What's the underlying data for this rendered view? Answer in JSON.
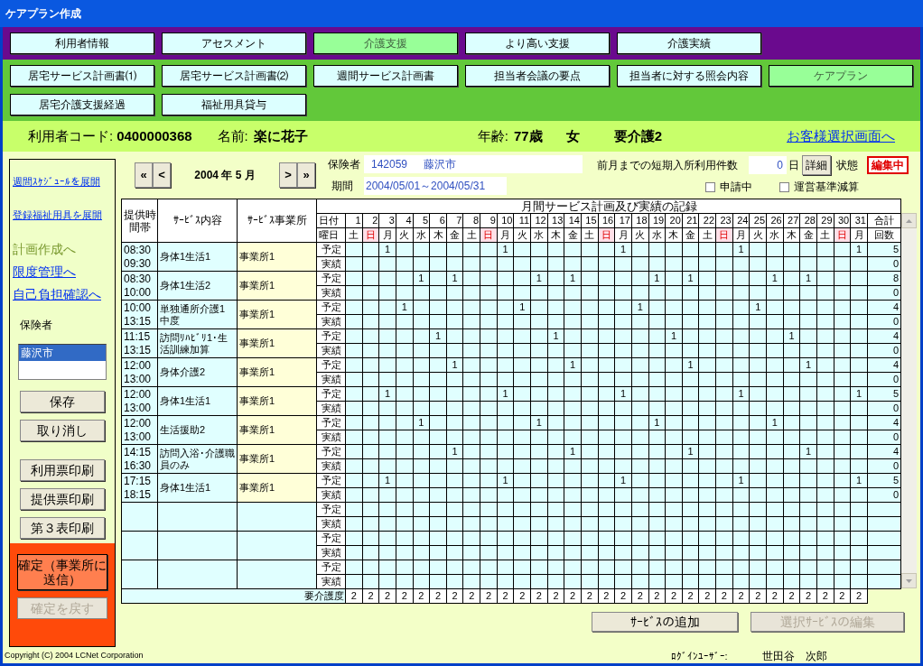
{
  "window": {
    "title": "ケアプラン作成"
  },
  "nav_primary": [
    {
      "label": "利用者情報",
      "selected": false
    },
    {
      "label": "アセスメント",
      "selected": false
    },
    {
      "label": "介護支援",
      "selected": true
    },
    {
      "label": "より高い支援",
      "selected": false
    },
    {
      "label": "介護実績",
      "selected": false
    }
  ],
  "nav_secondary": [
    {
      "label": "居宅サービス計画書⑴",
      "selected": false
    },
    {
      "label": "居宅サービス計画書⑵",
      "selected": false
    },
    {
      "label": "週間サービス計画書",
      "selected": false
    },
    {
      "label": "担当者会議の要点",
      "selected": false
    },
    {
      "label": "担当者に対する照会内容",
      "selected": false
    },
    {
      "label": "ケアプラン",
      "selected": true
    },
    {
      "label": "居宅介護支援経過",
      "selected": false
    },
    {
      "label": "福祉用具貸与",
      "selected": false
    }
  ],
  "user_bar": {
    "code_label": "利用者コード:",
    "code": "0400000368",
    "name_label": "名前:",
    "name": "楽に花子",
    "age_label": "年齢:",
    "age": "77歳",
    "sex": "女",
    "care_level": "要介護2",
    "back_link": "お客様選択画面へ"
  },
  "left_panel": {
    "expand_links": [
      "週間ｽｹｼﾞｭｰﾙを展開",
      "登録福祉用具を展開"
    ],
    "nav_links": [
      {
        "label": "計画作成へ",
        "disabled": true
      },
      {
        "label": "限度管理へ",
        "disabled": false
      },
      {
        "label": "自己負担確認へ",
        "disabled": false
      }
    ],
    "insurer_label": "保険者",
    "insurer_list": [
      {
        "label": "藤沢市",
        "selected": true
      }
    ],
    "edit_buttons": [
      "保存",
      "取り消し"
    ],
    "print_buttons": [
      "利用票印刷",
      "提供票印刷",
      "第３表印刷"
    ],
    "confirm_button": "確定（事業所に送信）",
    "undo_button": {
      "label": "確定を戻す",
      "disabled": true
    }
  },
  "month_nav": {
    "first": "«",
    "prev": "<",
    "month": "2004 年 5 月",
    "next": ">",
    "last": "»"
  },
  "insurer": {
    "label": "保険者",
    "code": "142059",
    "name": "藤沢市"
  },
  "period": {
    "label": "期間",
    "value": "2004/05/01～2004/05/31"
  },
  "short_stay": {
    "label": "前月までの短期入所利用件数",
    "value": "0",
    "unit": "日",
    "detail_button": "詳細"
  },
  "status": {
    "label": "状態",
    "value": "編集中"
  },
  "checkboxes": [
    {
      "label": "申請中",
      "checked": false
    },
    {
      "label": "運営基準減算",
      "checked": false
    }
  ],
  "schedule": {
    "headers": {
      "time": "提供時間帯",
      "service": "ｻｰﾋﾞｽ内容",
      "provider": "ｻｰﾋﾞｽ事業所",
      "title": "月間サービス計画及び実績の記録",
      "date_label": "日付",
      "weekday_label": "曜日",
      "total_label": "合計",
      "count_label": "回数"
    },
    "days": [
      {
        "day": "1",
        "weekday": "土",
        "sunday": false
      },
      {
        "day": "2",
        "weekday": "日",
        "sunday": true
      },
      {
        "day": "3",
        "weekday": "月",
        "sunday": false
      },
      {
        "day": "4",
        "weekday": "火",
        "sunday": false
      },
      {
        "day": "5",
        "weekday": "水",
        "sunday": false
      },
      {
        "day": "6",
        "weekday": "木",
        "sunday": false
      },
      {
        "day": "7",
        "weekday": "金",
        "sunday": false
      },
      {
        "day": "8",
        "weekday": "土",
        "sunday": false
      },
      {
        "day": "9",
        "weekday": "日",
        "sunday": true
      },
      {
        "day": "10",
        "weekday": "月",
        "sunday": false
      },
      {
        "day": "11",
        "weekday": "火",
        "sunday": false
      },
      {
        "day": "12",
        "weekday": "水",
        "sunday": false
      },
      {
        "day": "13",
        "weekday": "木",
        "sunday": false
      },
      {
        "day": "14",
        "weekday": "金",
        "sunday": false
      },
      {
        "day": "15",
        "weekday": "土",
        "sunday": false
      },
      {
        "day": "16",
        "weekday": "日",
        "sunday": true
      },
      {
        "day": "17",
        "weekday": "月",
        "sunday": false
      },
      {
        "day": "18",
        "weekday": "火",
        "sunday": false
      },
      {
        "day": "19",
        "weekday": "水",
        "sunday": false
      },
      {
        "day": "20",
        "weekday": "木",
        "sunday": false
      },
      {
        "day": "21",
        "weekday": "金",
        "sunday": false
      },
      {
        "day": "22",
        "weekday": "土",
        "sunday": false
      },
      {
        "day": "23",
        "weekday": "日",
        "sunday": true
      },
      {
        "day": "24",
        "weekday": "月",
        "sunday": false
      },
      {
        "day": "25",
        "weekday": "火",
        "sunday": false
      },
      {
        "day": "26",
        "weekday": "水",
        "sunday": false
      },
      {
        "day": "27",
        "weekday": "木",
        "sunday": false
      },
      {
        "day": "28",
        "weekday": "金",
        "sunday": false
      },
      {
        "day": "29",
        "weekday": "土",
        "sunday": false
      },
      {
        "day": "30",
        "weekday": "日",
        "sunday": true
      },
      {
        "day": "31",
        "weekday": "月",
        "sunday": false
      }
    ],
    "rows": [
      {
        "start": "08:30",
        "end": "09:30",
        "service": "身体1生活1",
        "provider": "事業所1",
        "plan_label": "予定",
        "actual_label": "実績",
        "planned": [
          {
            "kind": "blank"
          },
          {
            "kind": "blank"
          },
          {
            "kind": "mark",
            "text": "1"
          },
          {
            "kind": "blank"
          },
          {
            "kind": "blank"
          },
          {
            "kind": "blank"
          },
          {
            "kind": "blank"
          },
          {
            "kind": "blank"
          },
          {
            "kind": "blank"
          },
          {
            "kind": "mark",
            "text": "1"
          },
          {
            "kind": "blank"
          },
          {
            "kind": "blank"
          },
          {
            "kind": "blank"
          },
          {
            "kind": "blank"
          },
          {
            "kind": "blank"
          },
          {
            "kind": "blank"
          },
          {
            "kind": "mark",
            "text": "1"
          },
          {
            "kind": "blank"
          },
          {
            "kind": "blank"
          },
          {
            "kind": "blank"
          },
          {
            "kind": "blank"
          },
          {
            "kind": "blank"
          },
          {
            "kind": "blank"
          },
          {
            "kind": "mark",
            "text": "1"
          },
          {
            "kind": "blank"
          },
          {
            "kind": "blank"
          },
          {
            "kind": "blank"
          },
          {
            "kind": "blank"
          },
          {
            "kind": "blank"
          },
          {
            "kind": "blank"
          },
          {
            "kind": "mark",
            "text": "1"
          }
        ],
        "plan_total": "5",
        "actual_total": "0"
      },
      {
        "start": "08:30",
        "end": "10:00",
        "service": "身体1生活2",
        "provider": "事業所1",
        "plan_label": "予定",
        "actual_label": "実績",
        "planned": [
          {
            "kind": "blank"
          },
          {
            "kind": "blank"
          },
          {
            "kind": "blank"
          },
          {
            "kind": "blank"
          },
          {
            "kind": "mark",
            "text": "1"
          },
          {
            "kind": "blank"
          },
          {
            "kind": "mark",
            "text": "1"
          },
          {
            "kind": "blank"
          },
          {
            "kind": "blank"
          },
          {
            "kind": "blank"
          },
          {
            "kind": "blank"
          },
          {
            "kind": "mark",
            "text": "1"
          },
          {
            "kind": "blank"
          },
          {
            "kind": "mark",
            "text": "1"
          },
          {
            "kind": "blank"
          },
          {
            "kind": "blank"
          },
          {
            "kind": "blank"
          },
          {
            "kind": "blank"
          },
          {
            "kind": "mark",
            "text": "1"
          },
          {
            "kind": "blank"
          },
          {
            "kind": "mark",
            "text": "1"
          },
          {
            "kind": "blank"
          },
          {
            "kind": "blank"
          },
          {
            "kind": "blank"
          },
          {
            "kind": "blank"
          },
          {
            "kind": "mark",
            "text": "1"
          },
          {
            "kind": "blank"
          },
          {
            "kind": "mark",
            "text": "1"
          },
          {
            "kind": "blank"
          },
          {
            "kind": "blank"
          },
          {
            "kind": "blank"
          }
        ],
        "plan_total": "8",
        "actual_total": "0"
      },
      {
        "start": "10:00",
        "end": "13:15",
        "service": "単独通所介護1 中度",
        "provider": "事業所1",
        "plan_label": "予定",
        "actual_label": "実績",
        "planned": [
          {
            "kind": "blank"
          },
          {
            "kind": "blank"
          },
          {
            "kind": "blank"
          },
          {
            "kind": "mark",
            "text": "1"
          },
          {
            "kind": "blank"
          },
          {
            "kind": "blank"
          },
          {
            "kind": "blank"
          },
          {
            "kind": "blank"
          },
          {
            "kind": "blank"
          },
          {
            "kind": "blank"
          },
          {
            "kind": "mark",
            "text": "1"
          },
          {
            "kind": "blank"
          },
          {
            "kind": "blank"
          },
          {
            "kind": "blank"
          },
          {
            "kind": "blank"
          },
          {
            "kind": "blank"
          },
          {
            "kind": "blank"
          },
          {
            "kind": "mark",
            "text": "1"
          },
          {
            "kind": "blank"
          },
          {
            "kind": "blank"
          },
          {
            "kind": "blank"
          },
          {
            "kind": "blank"
          },
          {
            "kind": "blank"
          },
          {
            "kind": "blank"
          },
          {
            "kind": "mark",
            "text": "1"
          },
          {
            "kind": "blank"
          },
          {
            "kind": "blank"
          },
          {
            "kind": "blank"
          },
          {
            "kind": "blank"
          },
          {
            "kind": "blank"
          },
          {
            "kind": "blank"
          }
        ],
        "plan_total": "4",
        "actual_total": "0"
      },
      {
        "start": "11:15",
        "end": "13:15",
        "service": "訪問ﾘﾊﾋﾞﾘ1･生活訓練加算",
        "provider": "事業所1",
        "plan_label": "予定",
        "actual_label": "実績",
        "planned": [
          {
            "kind": "blank"
          },
          {
            "kind": "blank"
          },
          {
            "kind": "blank"
          },
          {
            "kind": "blank"
          },
          {
            "kind": "blank"
          },
          {
            "kind": "mark",
            "text": "1"
          },
          {
            "kind": "blank"
          },
          {
            "kind": "blank"
          },
          {
            "kind": "blank"
          },
          {
            "kind": "blank"
          },
          {
            "kind": "blank"
          },
          {
            "kind": "blank"
          },
          {
            "kind": "mark",
            "text": "1"
          },
          {
            "kind": "blank"
          },
          {
            "kind": "blank"
          },
          {
            "kind": "blank"
          },
          {
            "kind": "blank"
          },
          {
            "kind": "blank"
          },
          {
            "kind": "blank"
          },
          {
            "kind": "mark",
            "text": "1"
          },
          {
            "kind": "blank"
          },
          {
            "kind": "blank"
          },
          {
            "kind": "blank"
          },
          {
            "kind": "blank"
          },
          {
            "kind": "blank"
          },
          {
            "kind": "blank"
          },
          {
            "kind": "mark",
            "text": "1"
          },
          {
            "kind": "blank"
          },
          {
            "kind": "blank"
          },
          {
            "kind": "blank"
          },
          {
            "kind": "blank"
          }
        ],
        "plan_total": "4",
        "actual_total": "0"
      },
      {
        "start": "12:00",
        "end": "13:00",
        "service": "身体介護2",
        "provider": "事業所1",
        "plan_label": "予定",
        "actual_label": "実績",
        "planned": [
          {
            "kind": "blank"
          },
          {
            "kind": "blank"
          },
          {
            "kind": "blank"
          },
          {
            "kind": "blank"
          },
          {
            "kind": "blank"
          },
          {
            "kind": "blank"
          },
          {
            "kind": "mark",
            "text": "1"
          },
          {
            "kind": "blank"
          },
          {
            "kind": "blank"
          },
          {
            "kind": "blank"
          },
          {
            "kind": "blank"
          },
          {
            "kind": "blank"
          },
          {
            "kind": "blank"
          },
          {
            "kind": "mark",
            "text": "1"
          },
          {
            "kind": "blank"
          },
          {
            "kind": "blank"
          },
          {
            "kind": "blank"
          },
          {
            "kind": "blank"
          },
          {
            "kind": "blank"
          },
          {
            "kind": "blank"
          },
          {
            "kind": "mark",
            "text": "1"
          },
          {
            "kind": "blank"
          },
          {
            "kind": "blank"
          },
          {
            "kind": "blank"
          },
          {
            "kind": "blank"
          },
          {
            "kind": "blank"
          },
          {
            "kind": "blank"
          },
          {
            "kind": "mark",
            "text": "1"
          },
          {
            "kind": "blank"
          },
          {
            "kind": "blank"
          },
          {
            "kind": "blank"
          }
        ],
        "plan_total": "4",
        "actual_total": "0"
      },
      {
        "start": "12:00",
        "end": "13:00",
        "service": "身体1生活1",
        "provider": "事業所1",
        "plan_label": "予定",
        "actual_label": "実績",
        "planned": [
          {
            "kind": "blank"
          },
          {
            "kind": "blank"
          },
          {
            "kind": "mark",
            "text": "1"
          },
          {
            "kind": "blank"
          },
          {
            "kind": "blank"
          },
          {
            "kind": "blank"
          },
          {
            "kind": "blank"
          },
          {
            "kind": "blank"
          },
          {
            "kind": "blank"
          },
          {
            "kind": "mark",
            "text": "1"
          },
          {
            "kind": "blank"
          },
          {
            "kind": "blank"
          },
          {
            "kind": "blank"
          },
          {
            "kind": "blank"
          },
          {
            "kind": "blank"
          },
          {
            "kind": "blank"
          },
          {
            "kind": "mark",
            "text": "1"
          },
          {
            "kind": "blank"
          },
          {
            "kind": "blank"
          },
          {
            "kind": "blank"
          },
          {
            "kind": "blank"
          },
          {
            "kind": "blank"
          },
          {
            "kind": "blank"
          },
          {
            "kind": "mark",
            "text": "1"
          },
          {
            "kind": "blank"
          },
          {
            "kind": "blank"
          },
          {
            "kind": "blank"
          },
          {
            "kind": "blank"
          },
          {
            "kind": "blank"
          },
          {
            "kind": "blank"
          },
          {
            "kind": "mark",
            "text": "1"
          }
        ],
        "plan_total": "5",
        "actual_total": "0"
      },
      {
        "start": "12:00",
        "end": "13:00",
        "service": "生活援助2",
        "provider": "事業所1",
        "plan_label": "予定",
        "actual_label": "実績",
        "planned": [
          {
            "kind": "blank"
          },
          {
            "kind": "blank"
          },
          {
            "kind": "blank"
          },
          {
            "kind": "blank"
          },
          {
            "kind": "mark",
            "text": "1"
          },
          {
            "kind": "blank"
          },
          {
            "kind": "blank"
          },
          {
            "kind": "blank"
          },
          {
            "kind": "blank"
          },
          {
            "kind": "blank"
          },
          {
            "kind": "blank"
          },
          {
            "kind": "mark",
            "text": "1"
          },
          {
            "kind": "blank"
          },
          {
            "kind": "blank"
          },
          {
            "kind": "blank"
          },
          {
            "kind": "blank"
          },
          {
            "kind": "blank"
          },
          {
            "kind": "blank"
          },
          {
            "kind": "mark",
            "text": "1"
          },
          {
            "kind": "blank"
          },
          {
            "kind": "blank"
          },
          {
            "kind": "blank"
          },
          {
            "kind": "blank"
          },
          {
            "kind": "blank"
          },
          {
            "kind": "blank"
          },
          {
            "kind": "mark",
            "text": "1"
          },
          {
            "kind": "blank"
          },
          {
            "kind": "blank"
          },
          {
            "kind": "blank"
          },
          {
            "kind": "blank"
          },
          {
            "kind": "blank"
          }
        ],
        "plan_total": "4",
        "actual_total": "0"
      },
      {
        "start": "14:15",
        "end": "16:30",
        "service": "訪問入浴･介護職員のみ",
        "provider": "事業所1",
        "plan_label": "予定",
        "actual_label": "実績",
        "planned": [
          {
            "kind": "blank"
          },
          {
            "kind": "blank"
          },
          {
            "kind": "blank"
          },
          {
            "kind": "blank"
          },
          {
            "kind": "blank"
          },
          {
            "kind": "blank"
          },
          {
            "kind": "mark",
            "text": "1"
          },
          {
            "kind": "blank"
          },
          {
            "kind": "blank"
          },
          {
            "kind": "blank"
          },
          {
            "kind": "blank"
          },
          {
            "kind": "blank"
          },
          {
            "kind": "blank"
          },
          {
            "kind": "mark",
            "text": "1"
          },
          {
            "kind": "blank"
          },
          {
            "kind": "blank"
          },
          {
            "kind": "blank"
          },
          {
            "kind": "blank"
          },
          {
            "kind": "blank"
          },
          {
            "kind": "blank"
          },
          {
            "kind": "mark",
            "text": "1"
          },
          {
            "kind": "blank"
          },
          {
            "kind": "blank"
          },
          {
            "kind": "blank"
          },
          {
            "kind": "blank"
          },
          {
            "kind": "blank"
          },
          {
            "kind": "blank"
          },
          {
            "kind": "mark",
            "text": "1"
          },
          {
            "kind": "blank"
          },
          {
            "kind": "blank"
          },
          {
            "kind": "blank"
          }
        ],
        "plan_total": "4",
        "actual_total": "0"
      },
      {
        "start": "17:15",
        "end": "18:15",
        "service": "身体1生活1",
        "provider": "事業所1",
        "plan_label": "予定",
        "actual_label": "実績",
        "planned": [
          {
            "kind": "blank"
          },
          {
            "kind": "blank"
          },
          {
            "kind": "mark",
            "text": "1"
          },
          {
            "kind": "blank"
          },
          {
            "kind": "blank"
          },
          {
            "kind": "blank"
          },
          {
            "kind": "blank"
          },
          {
            "kind": "blank"
          },
          {
            "kind": "blank"
          },
          {
            "kind": "mark",
            "text": "1"
          },
          {
            "kind": "blank"
          },
          {
            "kind": "blank"
          },
          {
            "kind": "blank"
          },
          {
            "kind": "blank"
          },
          {
            "kind": "blank"
          },
          {
            "kind": "blank"
          },
          {
            "kind": "mark",
            "text": "1"
          },
          {
            "kind": "blank"
          },
          {
            "kind": "blank"
          },
          {
            "kind": "blank"
          },
          {
            "kind": "blank"
          },
          {
            "kind": "blank"
          },
          {
            "kind": "blank"
          },
          {
            "kind": "mark",
            "text": "1"
          },
          {
            "kind": "blank"
          },
          {
            "kind": "blank"
          },
          {
            "kind": "blank"
          },
          {
            "kind": "blank"
          },
          {
            "kind": "blank"
          },
          {
            "kind": "blank"
          },
          {
            "kind": "mark",
            "text": "1"
          }
        ],
        "plan_total": "5",
        "actual_total": "0"
      },
      {
        "plan_label": "予定",
        "actual_label": "実績"
      },
      {
        "plan_label": "予定",
        "actual_label": "実績"
      },
      {
        "plan_label": "予定",
        "actual_label": "実績"
      }
    ],
    "care_row": {
      "label": "要介護度",
      "values": [
        "2",
        "2",
        "2",
        "2",
        "2",
        "2",
        "2",
        "2",
        "2",
        "2",
        "2",
        "2",
        "2",
        "2",
        "2",
        "2",
        "2",
        "2",
        "2",
        "2",
        "2",
        "2",
        "2",
        "2",
        "2",
        "2",
        "2",
        "2",
        "2",
        "2",
        "2"
      ]
    }
  },
  "actions": [
    {
      "label": "ｻｰﾋﾞｽの追加",
      "disabled": false
    },
    {
      "label": "選択ｻｰﾋﾞｽの編集",
      "disabled": true
    }
  ],
  "footer": {
    "copyright": "Copyright (C) 2004 LCNet Corporation",
    "login_label": "ﾛｸﾞｲﾝﾕｰｻﾞｰ:",
    "login_user": "世田谷　次郎"
  }
}
